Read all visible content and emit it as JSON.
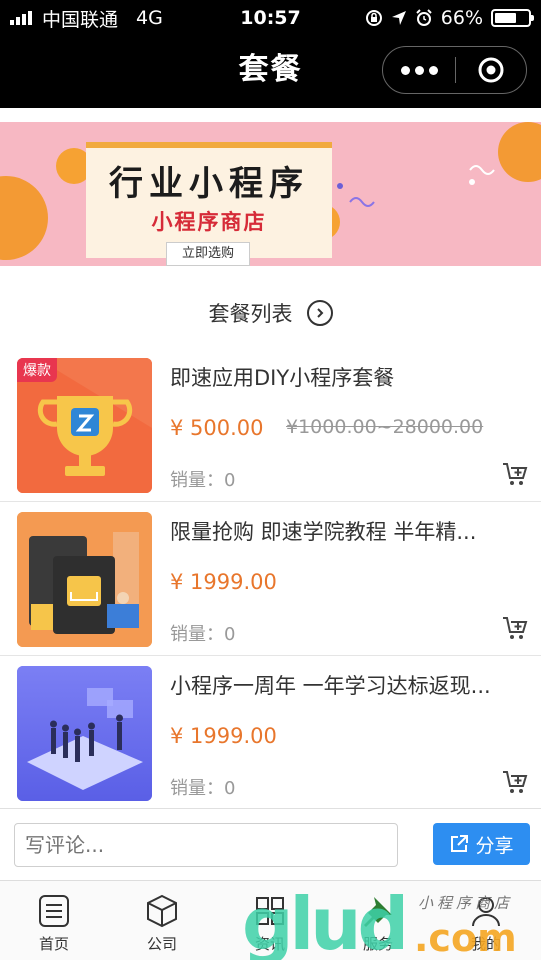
{
  "status_bar": {
    "carrier": "中国联通",
    "network": "4G",
    "time": "10:57",
    "battery": "66%",
    "battery_level": 0.66
  },
  "nav": {
    "title": "套餐"
  },
  "banner": {
    "title": "行业小程序",
    "subtitle": "小程序商店",
    "button": "立即选购"
  },
  "section": {
    "title": "套餐列表"
  },
  "products": [
    {
      "name": "即速应用DIY小程序套餐",
      "price": "¥ 500.00",
      "original_price": "¥1000.00~28000.00",
      "sales": "销量：0",
      "tag": "爆款"
    },
    {
      "name": "限量抢购 即速学院教程 半年精...",
      "price": "¥ 1999.00",
      "original_price": "",
      "sales": "销量：0",
      "tag": ""
    },
    {
      "name": "小程序一周年 一年学习达标返现...",
      "price": "¥ 1999.00",
      "original_price": "",
      "sales": "销量：0",
      "tag": ""
    }
  ],
  "comment": {
    "placeholder": "写评论...",
    "share_label": "分享"
  },
  "tabs": [
    {
      "label": "首页",
      "icon": "list-icon"
    },
    {
      "label": "公司",
      "icon": "cube-icon"
    },
    {
      "label": "资讯",
      "icon": "grid-icon"
    },
    {
      "label": "服务",
      "icon": "pin-icon"
    },
    {
      "label": "我的",
      "icon": "user-icon"
    }
  ],
  "watermark": {
    "main": "glud",
    "suffix": ".com",
    "cn": "小程序商店"
  },
  "colors": {
    "accent": "#e8762c",
    "share": "#2d8ef1",
    "banner_bg": "#f7b8c3",
    "hot_tag": "#e8364f"
  }
}
